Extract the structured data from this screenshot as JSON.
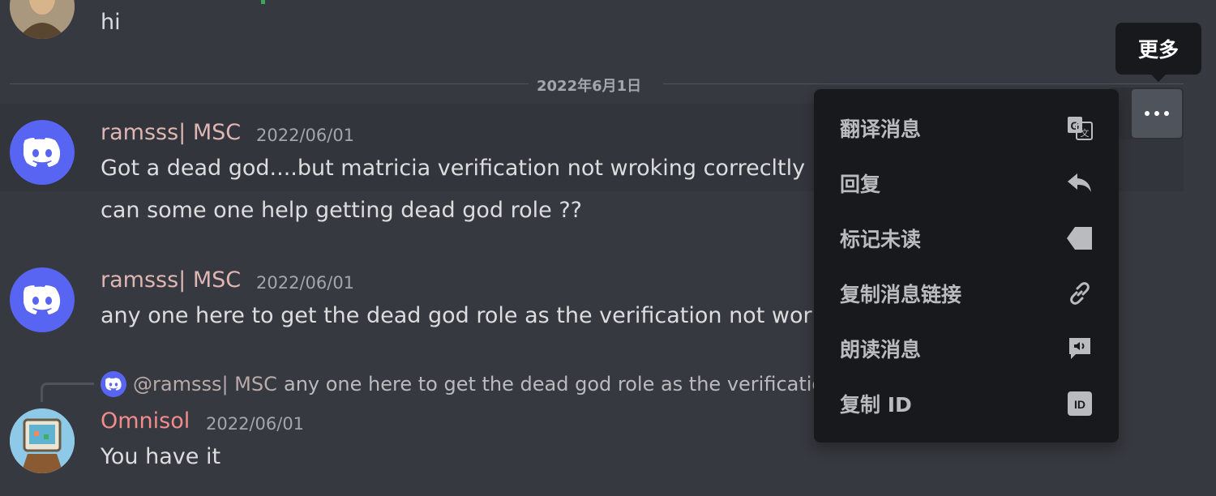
{
  "date_divider": "2022年6月1日",
  "tooltip": "更多",
  "top_message": {
    "text": "hi"
  },
  "messages": [
    {
      "username": "ramsss| MSC",
      "timestamp": "2022/06/01",
      "lines": [
        "Got a dead god....but matricia verification not wroking correcltly",
        "can some one help getting dead god role ??"
      ]
    },
    {
      "username": "ramsss| MSC",
      "timestamp": "2022/06/01",
      "lines": [
        "any one here to get the dead god role as the verification not workin"
      ]
    },
    {
      "reply": {
        "user": "@ramsss| MSC",
        "text": "any one here to get the dead god role as the verification n"
      },
      "username": "Omnisol",
      "timestamp": "2022/06/01",
      "lines": [
        "You have it"
      ]
    }
  ],
  "context_menu": {
    "items": [
      {
        "label": "翻译消息",
        "icon": "translate-icon"
      },
      {
        "label": "回复",
        "icon": "reply-icon"
      },
      {
        "label": "标记未读",
        "icon": "mark-unread-icon"
      },
      {
        "label": "复制消息链接",
        "icon": "link-icon"
      },
      {
        "label": "朗读消息",
        "icon": "speak-icon"
      },
      {
        "label": "复制 ID",
        "icon": "id-icon"
      }
    ]
  },
  "colors": {
    "background": "#36393f",
    "menu_background": "#18191c",
    "blurple": "#5865f2",
    "username_ramsss": "#dfb6b4",
    "username_omnisol": "#f28b8b"
  }
}
